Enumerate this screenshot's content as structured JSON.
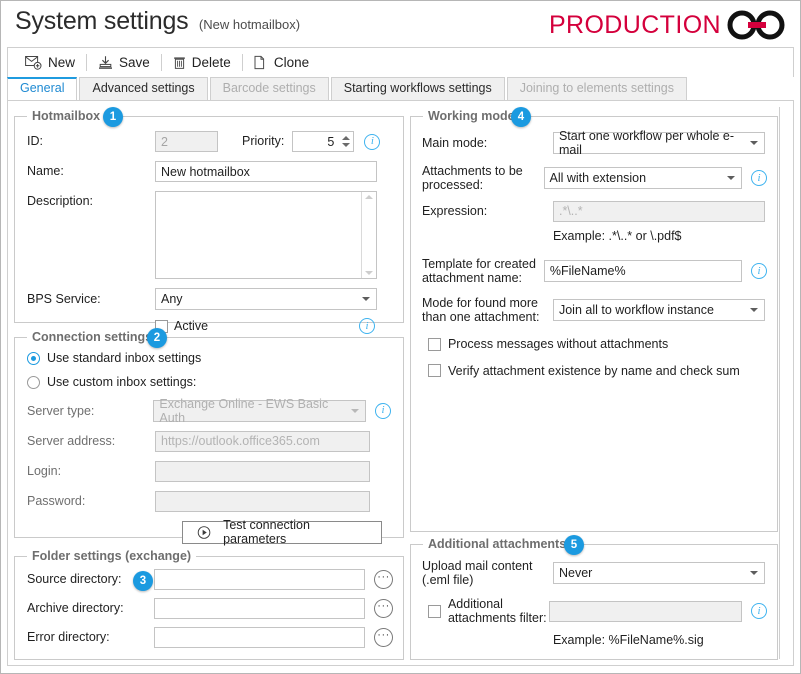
{
  "window": {
    "title": "System settings",
    "subtitle": "(New hotmailbox)",
    "brand": "PRODUCTION",
    "brand_color": "#d4003c"
  },
  "toolbar": {
    "new_label": "New",
    "save_label": "Save",
    "delete_label": "Delete",
    "clone_label": "Clone"
  },
  "tabs": [
    {
      "label": "General",
      "state": "active"
    },
    {
      "label": "Advanced settings",
      "state": "enabled"
    },
    {
      "label": "Barcode settings",
      "state": "disabled"
    },
    {
      "label": "Starting workflows settings",
      "state": "enabled"
    },
    {
      "label": "Joining to elements settings",
      "state": "disabled"
    }
  ],
  "hotmailbox": {
    "legend": "Hotmailbox",
    "badge": "1",
    "id_label": "ID:",
    "id_value": "2",
    "priority_label": "Priority:",
    "priority_value": "5",
    "name_label": "Name:",
    "name_value": "New hotmailbox",
    "description_label": "Description:",
    "description_value": "",
    "bps_label": "BPS Service:",
    "bps_value": "Any",
    "active_label": "Active",
    "active_checked": false
  },
  "connection": {
    "legend": "Connection settings",
    "badge": "2",
    "radio_standard": "Use standard inbox settings",
    "radio_custom": "Use custom inbox settings:",
    "selected": "standard",
    "server_type_label": "Server type:",
    "server_type_value": "Exchange Online - EWS Basic Auth",
    "server_address_label": "Server address:",
    "server_address_value": "https://outlook.office365.com",
    "login_label": "Login:",
    "login_value": "",
    "password_label": "Password:",
    "password_value": "",
    "test_button": "Test connection parameters"
  },
  "folder": {
    "legend": "Folder settings (exchange)",
    "badge": "3",
    "source_label": "Source directory:",
    "source_value": "",
    "archive_label": "Archive directory:",
    "archive_value": "",
    "error_label": "Error directory:",
    "error_value": "",
    "browse_glyph": "···"
  },
  "working_mode": {
    "legend": "Working mode",
    "badge": "4",
    "main_mode_label": "Main mode:",
    "main_mode_value": "Start one workflow per whole e-mail",
    "attachments_label": "Attachments to be processed:",
    "attachments_value": "All with extension",
    "expression_label": "Expression:",
    "expression_value": ".*\\..*",
    "expression_example": "Example:    .*\\..*   or      \\.pdf$",
    "template_label": "Template for created attachment name:",
    "template_value": "%FileName%",
    "mode_more_label": "Mode for found more than one attachment:",
    "mode_more_value": "Join all to workflow instance",
    "cb_process_label": "Process messages without attachments",
    "cb_process_checked": false,
    "cb_verify_label": "Verify attachment existence by name and check sum",
    "cb_verify_checked": false
  },
  "additional": {
    "legend": "Additional attachments:",
    "badge": "5",
    "upload_label": "Upload mail content (.eml file)",
    "upload_value": "Never",
    "filter_label": "Additional attachments filter:",
    "filter_value": "",
    "filter_checked": false,
    "filter_example": "Example:    %FileName%.sig"
  }
}
